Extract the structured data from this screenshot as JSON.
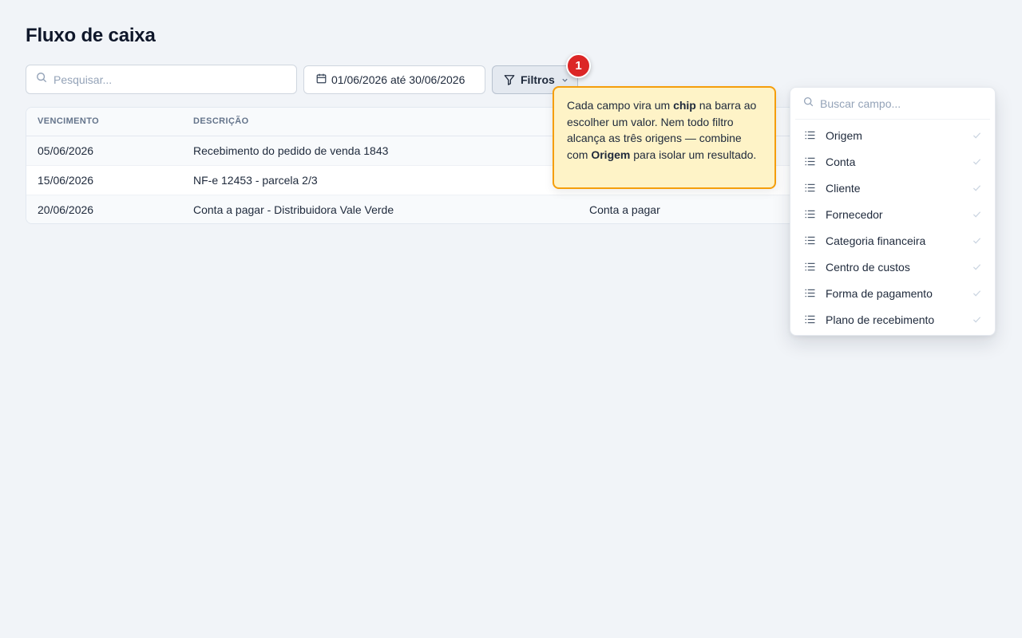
{
  "page": {
    "title": "Fluxo de caixa"
  },
  "toolbar": {
    "search_placeholder": "Pesquisar...",
    "date_range": "01/06/2026 até 30/06/2026",
    "filters_label": "Filtros",
    "badge_count": "1"
  },
  "table": {
    "headers": [
      "VENCIMENTO",
      "DESCRIÇÃO"
    ],
    "rows": [
      {
        "vencimento": "05/06/2026",
        "descricao": "Recebimento do pedido de venda 1843",
        "origem": ""
      },
      {
        "vencimento": "15/06/2026",
        "descricao": "NF-e 12453 - parcela 2/3",
        "origem": ""
      },
      {
        "vencimento": "20/06/2026",
        "descricao": "Conta a pagar - Distribuidora Vale Verde",
        "origem": "Conta a pagar"
      }
    ]
  },
  "tooltip": {
    "t1": "Cada campo vira um ",
    "b1": "chip",
    "t2": " na barra ao escolher um valor. Nem todo filtro alcança as três origens — combine com ",
    "b2": "Origem",
    "t3": " para isolar um resultado."
  },
  "dropdown": {
    "search_placeholder": "Buscar campo...",
    "items": [
      {
        "label": "Origem"
      },
      {
        "label": "Conta"
      },
      {
        "label": "Cliente"
      },
      {
        "label": "Fornecedor"
      },
      {
        "label": "Categoria financeira"
      },
      {
        "label": "Centro de custos"
      },
      {
        "label": "Forma de pagamento"
      },
      {
        "label": "Plano de recebimento"
      }
    ]
  },
  "colors": {
    "background": "#f1f4f8",
    "badge": "#dc2626",
    "tooltip_bg": "#fef3c7",
    "tooltip_border": "#f59e0b"
  },
  "icons": [
    "search-icon",
    "calendar-icon",
    "filter-icon",
    "chevron-down-icon",
    "list-icon",
    "check-icon"
  ]
}
